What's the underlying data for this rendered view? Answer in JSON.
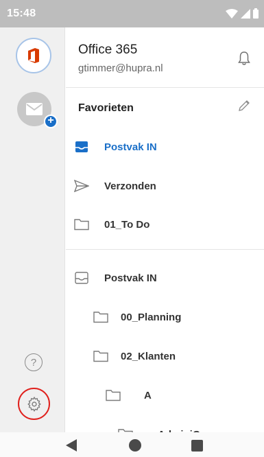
{
  "status_bar": {
    "time": "15:48"
  },
  "account": {
    "name": "Office 365",
    "email": "gtimmer@hupra.nl"
  },
  "favorites": {
    "title": "Favorieten",
    "items": [
      {
        "label": "Postvak IN",
        "icon": "inbox-icon",
        "active": true
      },
      {
        "label": "Verzonden",
        "icon": "send-icon",
        "active": false
      },
      {
        "label": "01_To Do",
        "icon": "folder-icon",
        "active": false
      }
    ]
  },
  "folders": {
    "items": [
      {
        "label": "Postvak IN",
        "icon": "inbox-icon",
        "level": 0
      },
      {
        "label": "00_Planning",
        "icon": "folder-icon",
        "level": 1
      },
      {
        "label": "02_Klanten",
        "icon": "folder-icon",
        "level": 1
      },
      {
        "label": "A",
        "icon": "folder-icon",
        "level": 2
      },
      {
        "label": "AdminiCare",
        "icon": "folder-icon",
        "level": 3
      }
    ]
  },
  "rail": {
    "help_glyph": "?",
    "add_glyph": "+"
  },
  "colors": {
    "accent": "#1a6fc8",
    "settings_highlight": "#e0201c",
    "office_red": "#d83b01"
  }
}
